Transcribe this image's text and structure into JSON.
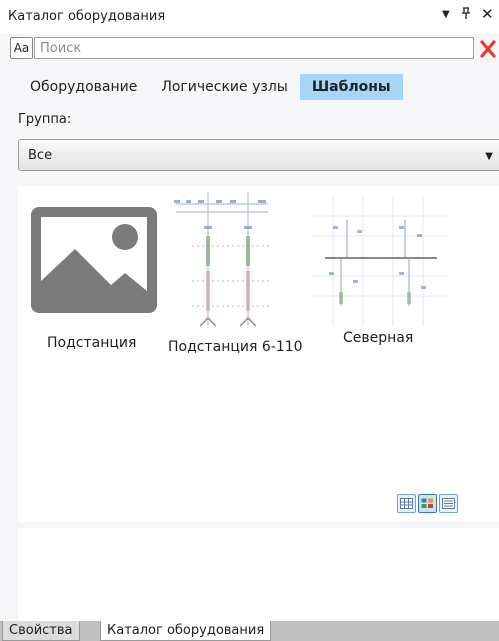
{
  "panel": {
    "title": "Каталог оборудования",
    "dropdown_glyph": "▼",
    "pin_glyph": "ҭ",
    "close_glyph": "✕"
  },
  "search": {
    "case_label": "Aa",
    "placeholder": "Поиск",
    "value": "",
    "clear_glyph": "✕"
  },
  "tabs": [
    {
      "label": "Оборудование",
      "active": false
    },
    {
      "label": "Логические узлы",
      "active": false
    },
    {
      "label": "Шаблоны",
      "active": true
    }
  ],
  "group": {
    "label": "Группа:",
    "selected": "Все"
  },
  "templates": [
    {
      "name": "Подстанция",
      "thumbnail": "placeholder-image-icon"
    },
    {
      "name": "Подстанция 6-110",
      "thumbnail": "schematic-thumbnail"
    },
    {
      "name": "Северная",
      "thumbnail": "schematic-thumbnail"
    }
  ],
  "view_modes": [
    "table-view-icon",
    "tiles-view-icon",
    "list-view-icon"
  ],
  "bottom_tabs": [
    {
      "label": "Свойства",
      "active": false
    },
    {
      "label": "Каталог оборудования",
      "active": true
    }
  ],
  "colors": {
    "active_tab": "#a8d4f5",
    "clear_icon": "#e03c2f",
    "placeholder_icon": "#7b7b7b"
  }
}
